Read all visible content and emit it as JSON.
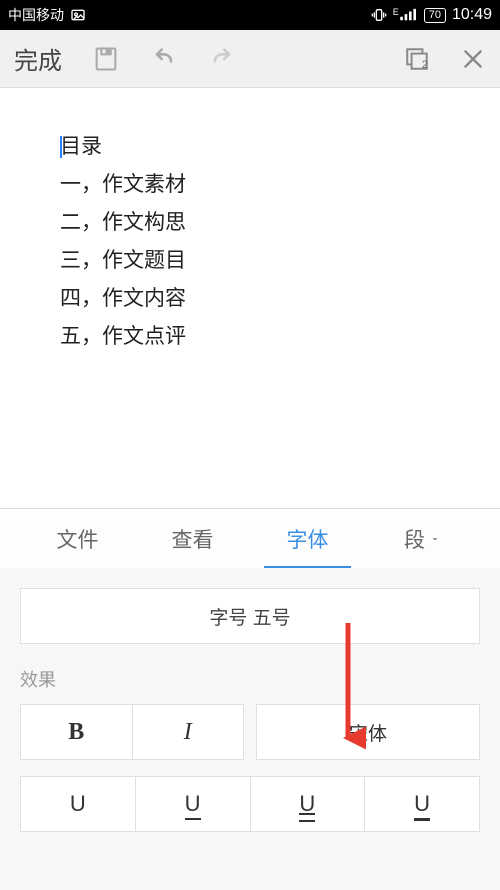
{
  "status": {
    "carrier": "中国移动",
    "battery": "70",
    "time": "10:49",
    "network_label": "E"
  },
  "toolbar": {
    "done_label": "完成",
    "pages_count": "2"
  },
  "document": {
    "lines": [
      "目录",
      "一，作文素材",
      "二，作文构思",
      "三，作文题目",
      "四，作文内容",
      "五，作文点评"
    ]
  },
  "tabs": {
    "items": [
      "文件",
      "查看",
      "字体",
      "段"
    ],
    "active_index": 2
  },
  "font_panel": {
    "size_label": "字号 五号",
    "effects_label": "效果",
    "bold": "B",
    "italic": "I",
    "font_name": "宋体",
    "u_char": "U"
  }
}
